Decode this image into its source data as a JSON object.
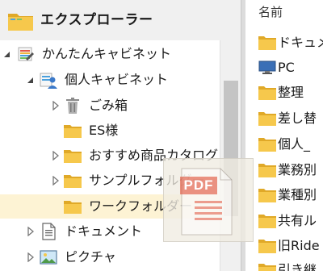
{
  "header": {
    "title": "エクスプローラー",
    "icon": "folder-icon"
  },
  "tree": [
    {
      "label": "かんたんキャビネット",
      "icon": "cabinet-icon",
      "expanded": true
    },
    {
      "label": "個人キャビネット",
      "icon": "personal-cabinet-icon",
      "expanded": true
    },
    {
      "label": "ごみ箱",
      "icon": "trash-icon",
      "expanded": false
    },
    {
      "label": "ES様",
      "icon": "folder-icon"
    },
    {
      "label": "おすすめ商品カタログ",
      "icon": "folder-icon",
      "expanded": false
    },
    {
      "label": "サンプルフォルダー",
      "icon": "folder-icon",
      "expanded": false
    },
    {
      "label": "ワークフォルダー",
      "icon": "folder-icon",
      "selected": true
    },
    {
      "label": "ドキュメント",
      "icon": "document-icon",
      "expanded": false
    },
    {
      "label": "ピクチャ",
      "icon": "picture-icon",
      "expanded": false
    }
  ],
  "file_list": {
    "column_header": "名前",
    "items": [
      {
        "label": "ドキュメ",
        "icon": "folder-icon"
      },
      {
        "label": "PC",
        "icon": "pc-icon"
      },
      {
        "label": "整理",
        "icon": "folder-icon"
      },
      {
        "label": "差し替",
        "icon": "folder-icon"
      },
      {
        "label": "個人_",
        "icon": "folder-icon"
      },
      {
        "label": "業務別",
        "icon": "folder-icon"
      },
      {
        "label": "業種別",
        "icon": "folder-icon"
      },
      {
        "label": "共有ル",
        "icon": "folder-icon"
      },
      {
        "label": "旧Ride",
        "icon": "folder-icon"
      },
      {
        "label": "引き継",
        "icon": "folder-icon"
      }
    ]
  },
  "drag_ghost": {
    "badge": "PDF",
    "icon": "pdf-file-icon"
  },
  "colors": {
    "folder": "#f6c84c",
    "folder_dark": "#e0a928",
    "selected_row": "#fdf3d4",
    "pdf_red": "#e0523a",
    "header_bg": "#f0f0f0"
  }
}
